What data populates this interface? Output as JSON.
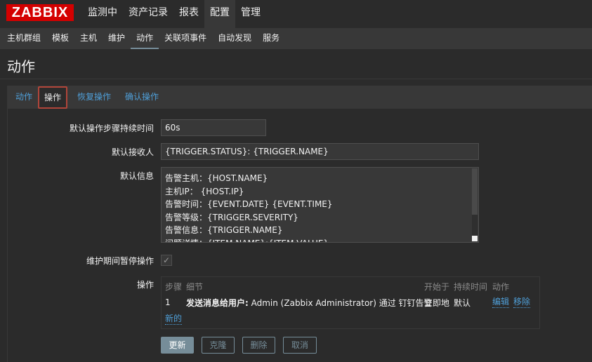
{
  "brand": {
    "logo_text": "ZABBIX",
    "logo_color": "#d40000"
  },
  "top_nav": [
    "监测中",
    "资产记录",
    "报表",
    "配置",
    "管理"
  ],
  "sub_nav": [
    "主机群组",
    "模板",
    "主机",
    "维护",
    "动作",
    "关联项事件",
    "自动发现",
    "服务"
  ],
  "page": {
    "title": "动作"
  },
  "tabs": [
    "动作",
    "操作",
    "恢复操作",
    "确认操作"
  ],
  "form": {
    "step_duration": {
      "label": "默认操作步骤持续时间",
      "value": "60s"
    },
    "default_subject": {
      "label": "默认接收人",
      "value": "{TRIGGER.STATUS}: {TRIGGER.NAME}"
    },
    "default_message": {
      "label": "默认信息",
      "lines": [
        "告警主机：{HOST.NAME}",
        "主机IP： {HOST.IP}",
        "告警时间：{EVENT.DATE} {EVENT.TIME}",
        "告警等级：{TRIGGER.SEVERITY}",
        "告警信息：{TRIGGER.NAME}",
        "问题详情：{ITEM.NAME}:{ITEM.VALUE}"
      ]
    },
    "pause_in_maintenance": {
      "label": "维护期间暂停操作",
      "checked": true,
      "check_glyph": "✓"
    },
    "operations": {
      "label": "操作",
      "headers": {
        "step": "步骤",
        "details": "细节",
        "start_in": "开始于",
        "duration": "持续时间",
        "action": "动作"
      },
      "rows": [
        {
          "step": "1",
          "details_bold": "发送消息给用户:",
          "details_rest": " Admin (Zabbix Administrator) 通过 钉钉告警",
          "start_in": "立即地",
          "duration": "默认",
          "edit": "编辑",
          "remove": "移除"
        }
      ],
      "new_link": "新的"
    }
  },
  "buttons": {
    "update": "更新",
    "clone": "克隆",
    "delete": "删除",
    "cancel": "取消"
  }
}
